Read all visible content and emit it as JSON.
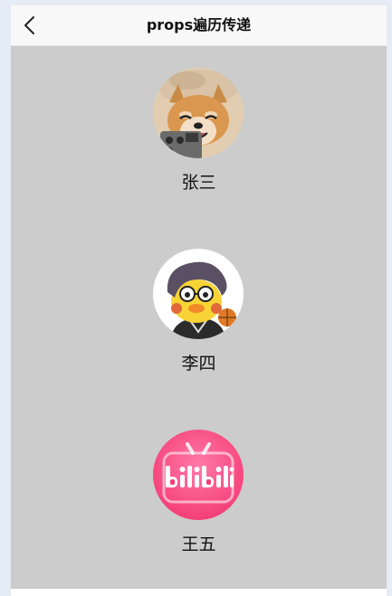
{
  "navbar": {
    "title": "props遍历传递",
    "back_icon": "chevron-left-icon"
  },
  "people": [
    {
      "name": "张三",
      "avatar": "shiba-dog-avatar"
    },
    {
      "name": "李四",
      "avatar": "cartoon-duck-avatar"
    },
    {
      "name": "王五",
      "avatar": "bilibili-logo-avatar"
    }
  ],
  "colors": {
    "content_bg": "#cccccc",
    "navbar_bg": "#f8f8f8",
    "bilibili_pink": "#ff4f8a"
  }
}
